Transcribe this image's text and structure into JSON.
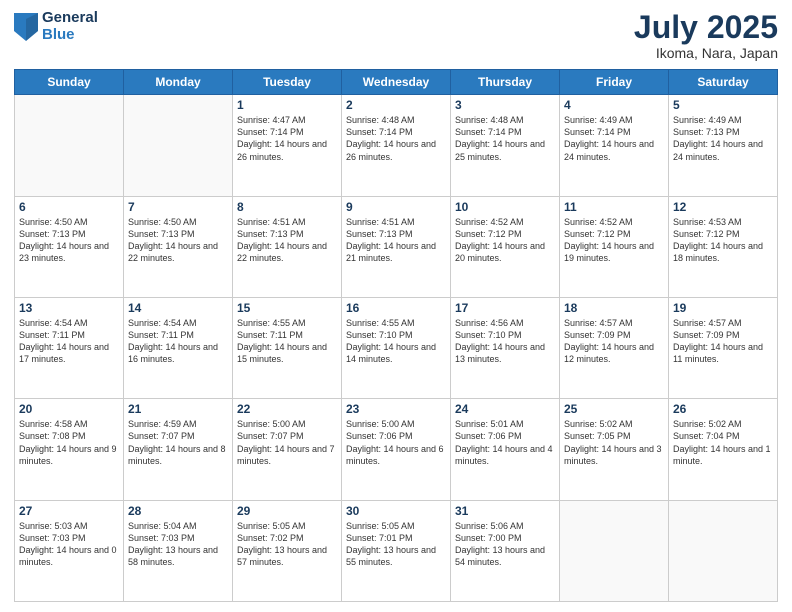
{
  "logo": {
    "general": "General",
    "blue": "Blue"
  },
  "header": {
    "month": "July 2025",
    "location": "Ikoma, Nara, Japan"
  },
  "weekdays": [
    "Sunday",
    "Monday",
    "Tuesday",
    "Wednesday",
    "Thursday",
    "Friday",
    "Saturday"
  ],
  "weeks": [
    [
      {
        "day": "",
        "sunrise": "",
        "sunset": "",
        "daylight": ""
      },
      {
        "day": "",
        "sunrise": "",
        "sunset": "",
        "daylight": ""
      },
      {
        "day": "1",
        "sunrise": "Sunrise: 4:47 AM",
        "sunset": "Sunset: 7:14 PM",
        "daylight": "Daylight: 14 hours and 26 minutes."
      },
      {
        "day": "2",
        "sunrise": "Sunrise: 4:48 AM",
        "sunset": "Sunset: 7:14 PM",
        "daylight": "Daylight: 14 hours and 26 minutes."
      },
      {
        "day": "3",
        "sunrise": "Sunrise: 4:48 AM",
        "sunset": "Sunset: 7:14 PM",
        "daylight": "Daylight: 14 hours and 25 minutes."
      },
      {
        "day": "4",
        "sunrise": "Sunrise: 4:49 AM",
        "sunset": "Sunset: 7:14 PM",
        "daylight": "Daylight: 14 hours and 24 minutes."
      },
      {
        "day": "5",
        "sunrise": "Sunrise: 4:49 AM",
        "sunset": "Sunset: 7:13 PM",
        "daylight": "Daylight: 14 hours and 24 minutes."
      }
    ],
    [
      {
        "day": "6",
        "sunrise": "Sunrise: 4:50 AM",
        "sunset": "Sunset: 7:13 PM",
        "daylight": "Daylight: 14 hours and 23 minutes."
      },
      {
        "day": "7",
        "sunrise": "Sunrise: 4:50 AM",
        "sunset": "Sunset: 7:13 PM",
        "daylight": "Daylight: 14 hours and 22 minutes."
      },
      {
        "day": "8",
        "sunrise": "Sunrise: 4:51 AM",
        "sunset": "Sunset: 7:13 PM",
        "daylight": "Daylight: 14 hours and 22 minutes."
      },
      {
        "day": "9",
        "sunrise": "Sunrise: 4:51 AM",
        "sunset": "Sunset: 7:13 PM",
        "daylight": "Daylight: 14 hours and 21 minutes."
      },
      {
        "day": "10",
        "sunrise": "Sunrise: 4:52 AM",
        "sunset": "Sunset: 7:12 PM",
        "daylight": "Daylight: 14 hours and 20 minutes."
      },
      {
        "day": "11",
        "sunrise": "Sunrise: 4:52 AM",
        "sunset": "Sunset: 7:12 PM",
        "daylight": "Daylight: 14 hours and 19 minutes."
      },
      {
        "day": "12",
        "sunrise": "Sunrise: 4:53 AM",
        "sunset": "Sunset: 7:12 PM",
        "daylight": "Daylight: 14 hours and 18 minutes."
      }
    ],
    [
      {
        "day": "13",
        "sunrise": "Sunrise: 4:54 AM",
        "sunset": "Sunset: 7:11 PM",
        "daylight": "Daylight: 14 hours and 17 minutes."
      },
      {
        "day": "14",
        "sunrise": "Sunrise: 4:54 AM",
        "sunset": "Sunset: 7:11 PM",
        "daylight": "Daylight: 14 hours and 16 minutes."
      },
      {
        "day": "15",
        "sunrise": "Sunrise: 4:55 AM",
        "sunset": "Sunset: 7:11 PM",
        "daylight": "Daylight: 14 hours and 15 minutes."
      },
      {
        "day": "16",
        "sunrise": "Sunrise: 4:55 AM",
        "sunset": "Sunset: 7:10 PM",
        "daylight": "Daylight: 14 hours and 14 minutes."
      },
      {
        "day": "17",
        "sunrise": "Sunrise: 4:56 AM",
        "sunset": "Sunset: 7:10 PM",
        "daylight": "Daylight: 14 hours and 13 minutes."
      },
      {
        "day": "18",
        "sunrise": "Sunrise: 4:57 AM",
        "sunset": "Sunset: 7:09 PM",
        "daylight": "Daylight: 14 hours and 12 minutes."
      },
      {
        "day": "19",
        "sunrise": "Sunrise: 4:57 AM",
        "sunset": "Sunset: 7:09 PM",
        "daylight": "Daylight: 14 hours and 11 minutes."
      }
    ],
    [
      {
        "day": "20",
        "sunrise": "Sunrise: 4:58 AM",
        "sunset": "Sunset: 7:08 PM",
        "daylight": "Daylight: 14 hours and 9 minutes."
      },
      {
        "day": "21",
        "sunrise": "Sunrise: 4:59 AM",
        "sunset": "Sunset: 7:07 PM",
        "daylight": "Daylight: 14 hours and 8 minutes."
      },
      {
        "day": "22",
        "sunrise": "Sunrise: 5:00 AM",
        "sunset": "Sunset: 7:07 PM",
        "daylight": "Daylight: 14 hours and 7 minutes."
      },
      {
        "day": "23",
        "sunrise": "Sunrise: 5:00 AM",
        "sunset": "Sunset: 7:06 PM",
        "daylight": "Daylight: 14 hours and 6 minutes."
      },
      {
        "day": "24",
        "sunrise": "Sunrise: 5:01 AM",
        "sunset": "Sunset: 7:06 PM",
        "daylight": "Daylight: 14 hours and 4 minutes."
      },
      {
        "day": "25",
        "sunrise": "Sunrise: 5:02 AM",
        "sunset": "Sunset: 7:05 PM",
        "daylight": "Daylight: 14 hours and 3 minutes."
      },
      {
        "day": "26",
        "sunrise": "Sunrise: 5:02 AM",
        "sunset": "Sunset: 7:04 PM",
        "daylight": "Daylight: 14 hours and 1 minute."
      }
    ],
    [
      {
        "day": "27",
        "sunrise": "Sunrise: 5:03 AM",
        "sunset": "Sunset: 7:03 PM",
        "daylight": "Daylight: 14 hours and 0 minutes."
      },
      {
        "day": "28",
        "sunrise": "Sunrise: 5:04 AM",
        "sunset": "Sunset: 7:03 PM",
        "daylight": "Daylight: 13 hours and 58 minutes."
      },
      {
        "day": "29",
        "sunrise": "Sunrise: 5:05 AM",
        "sunset": "Sunset: 7:02 PM",
        "daylight": "Daylight: 13 hours and 57 minutes."
      },
      {
        "day": "30",
        "sunrise": "Sunrise: 5:05 AM",
        "sunset": "Sunset: 7:01 PM",
        "daylight": "Daylight: 13 hours and 55 minutes."
      },
      {
        "day": "31",
        "sunrise": "Sunrise: 5:06 AM",
        "sunset": "Sunset: 7:00 PM",
        "daylight": "Daylight: 13 hours and 54 minutes."
      },
      {
        "day": "",
        "sunrise": "",
        "sunset": "",
        "daylight": ""
      },
      {
        "day": "",
        "sunrise": "",
        "sunset": "",
        "daylight": ""
      }
    ]
  ]
}
